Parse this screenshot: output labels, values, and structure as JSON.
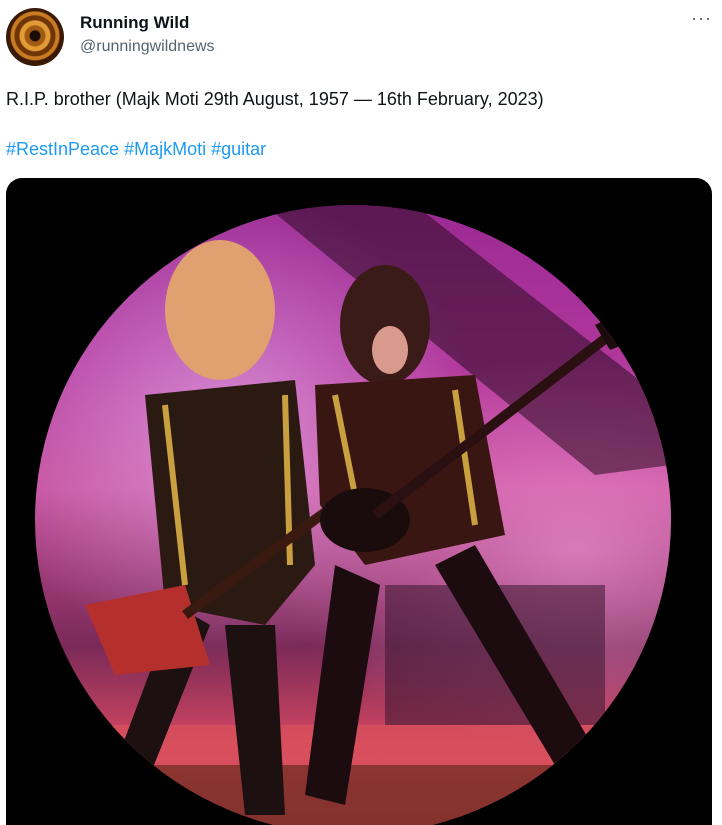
{
  "tweet": {
    "author": {
      "display_name": "Running Wild",
      "handle": "@runningwildnews"
    },
    "more_icon": "more-icon",
    "text": "R.I.P. brother (Majk Moti 29th August, 1957 — 16th February, 2023)",
    "hashtags": [
      "#RestInPeace",
      "#MajkMoti",
      "#guitar"
    ],
    "accent_color": "#1d9bf0"
  }
}
